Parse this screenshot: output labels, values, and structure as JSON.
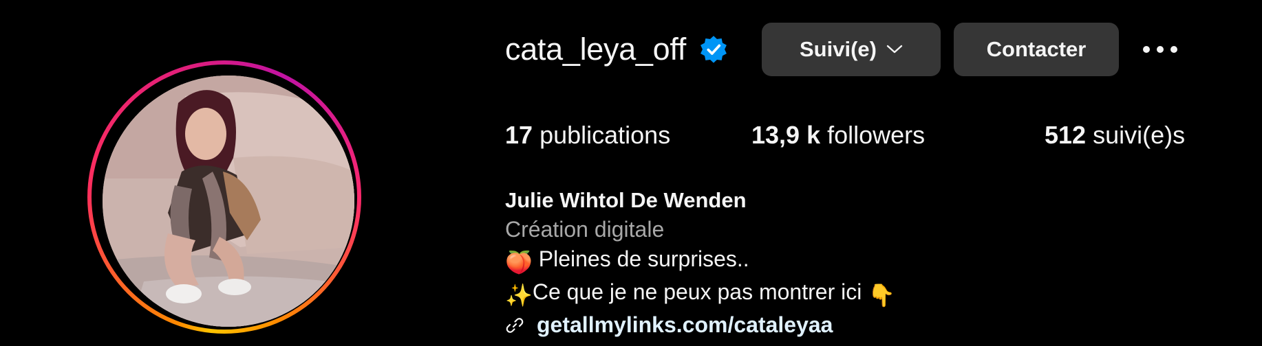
{
  "profile": {
    "username": "cata_leya_off",
    "verified_icon": "verified-badge-icon",
    "follow_button_label": "Suivi(e)",
    "contact_button_label": "Contacter",
    "more_icon": "more-options-icon"
  },
  "stats": {
    "posts_count": "17",
    "posts_label": "publications",
    "followers_count": "13,9 k",
    "followers_label": "followers",
    "following_count": "512",
    "following_label": "suivi(e)s"
  },
  "bio": {
    "full_name": "Julie Wihtol De Wenden",
    "category": "Création digitale",
    "line1_emoji": "🍑",
    "line1_text": " Pleines de surprises..",
    "line2_emoji": "✨",
    "line2_text": "Ce que je ne peux pas montrer ici ",
    "line2_trailing_emoji": "👇",
    "link_icon": "link-icon",
    "link": "getallmylinks.com/cataleyaa"
  },
  "colors": {
    "background": "#000000",
    "button_bg": "#363636",
    "text_primary": "#f5f5f5",
    "text_secondary": "#a8a8a8",
    "link_text": "#e0f1ff",
    "verified_blue": "#0095f6"
  }
}
